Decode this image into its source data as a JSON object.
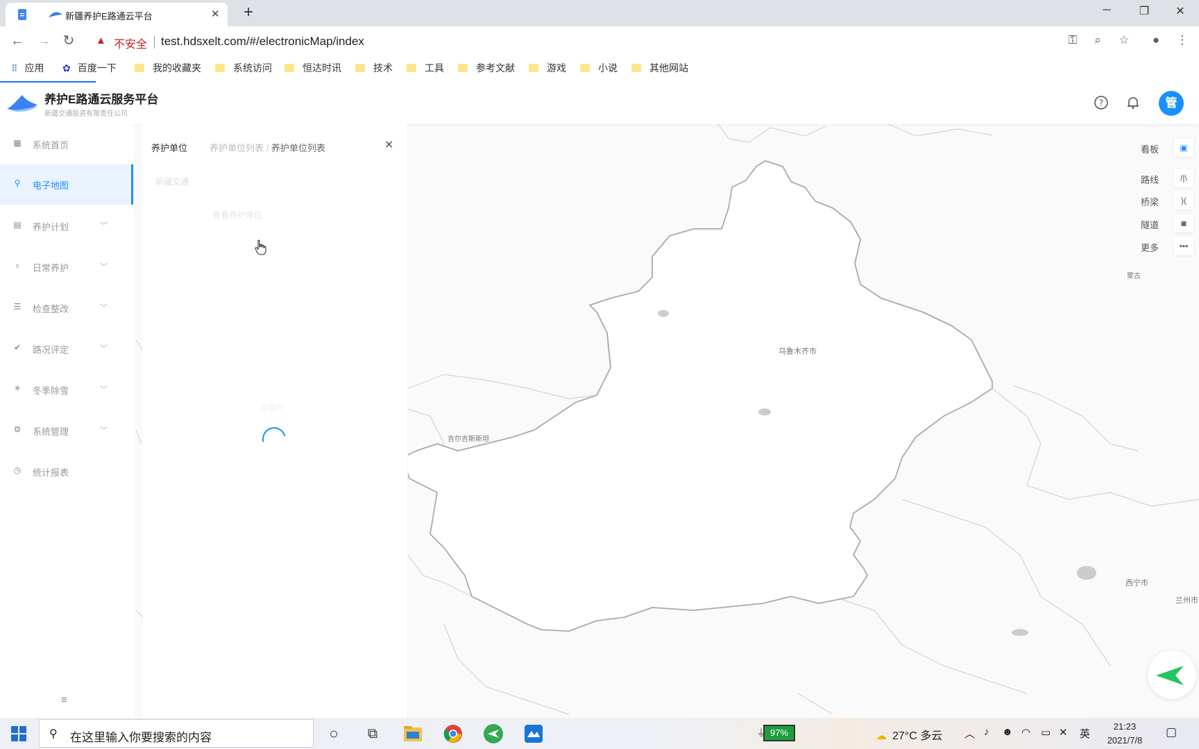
{
  "browser": {
    "tab_title": "新疆养护E路通云平台",
    "tab_close": "✕",
    "new_tab": "+",
    "window_controls": {
      "minimize": "─",
      "restore": "❐",
      "close": "✕"
    },
    "security_label": "不安全",
    "url": "test.hdsxelt.com/#/electronicMap/index",
    "bookmarks": [
      "应用",
      "百度一下",
      "我的收藏夹",
      "系统访问",
      "恒达时讯",
      "技术",
      "工具",
      "参考文献",
      "游戏",
      "小说",
      "其他网站"
    ]
  },
  "app": {
    "title": "养护E路通云服务平台",
    "subtitle": "新疆交通投资有限责任公司",
    "avatar": "管"
  },
  "sidebar": {
    "items": [
      {
        "label": "系统首页",
        "icon": "grid-icon",
        "has_children": false
      },
      {
        "label": "电子地图",
        "icon": "map-pin-icon",
        "has_children": false,
        "active": true
      },
      {
        "label": "养护计划",
        "icon": "calendar-icon",
        "has_children": true
      },
      {
        "label": "日常养护",
        "icon": "wrench-icon",
        "has_children": true
      },
      {
        "label": "检查整改",
        "icon": "checklist-icon",
        "has_children": true
      },
      {
        "label": "路况评定",
        "icon": "check-mark-icon",
        "has_children": true
      },
      {
        "label": "冬季除雪",
        "icon": "snowflake-icon",
        "has_children": true
      },
      {
        "label": "系统管理",
        "icon": "gear-icon",
        "has_children": true
      },
      {
        "label": "统计报表",
        "icon": "clock-icon",
        "has_children": false
      }
    ],
    "collapse_icon": "≡"
  },
  "panel": {
    "title": "养护单位",
    "breadcrumb_parent": "养护单位列表",
    "breadcrumb_sep": "/",
    "breadcrumb_current": "养护单位列表",
    "close": "✕",
    "search_text": "新疆交通",
    "placeholder_text": "查看养护单位",
    "loading_text": "加载中"
  },
  "map": {
    "labels": {
      "urumqi": "乌鲁木齐市",
      "kyrgyzstan": "吉尔吉斯斯坦",
      "mongolia": "蒙古",
      "xining": "西宁市",
      "lanzhou": "兰州市"
    },
    "controls": [
      {
        "label": "看板",
        "icon": "monitor-icon",
        "glyph": "▣"
      },
      {
        "label": "路线",
        "icon": "route-icon",
        "glyph": "/|\\"
      },
      {
        "label": "桥梁",
        "icon": "bridge-icon",
        "glyph": ")("
      },
      {
        "label": "隧道",
        "icon": "tunnel-icon",
        "glyph": "◙"
      },
      {
        "label": "更多",
        "icon": "more-icon",
        "glyph": "•••"
      }
    ]
  },
  "taskbar": {
    "search_placeholder": "在这里输入你要搜索的内容",
    "battery": "97%",
    "weather": "27°C 多云",
    "ime": "英",
    "time": "21:23",
    "date": "2021/7/8"
  }
}
